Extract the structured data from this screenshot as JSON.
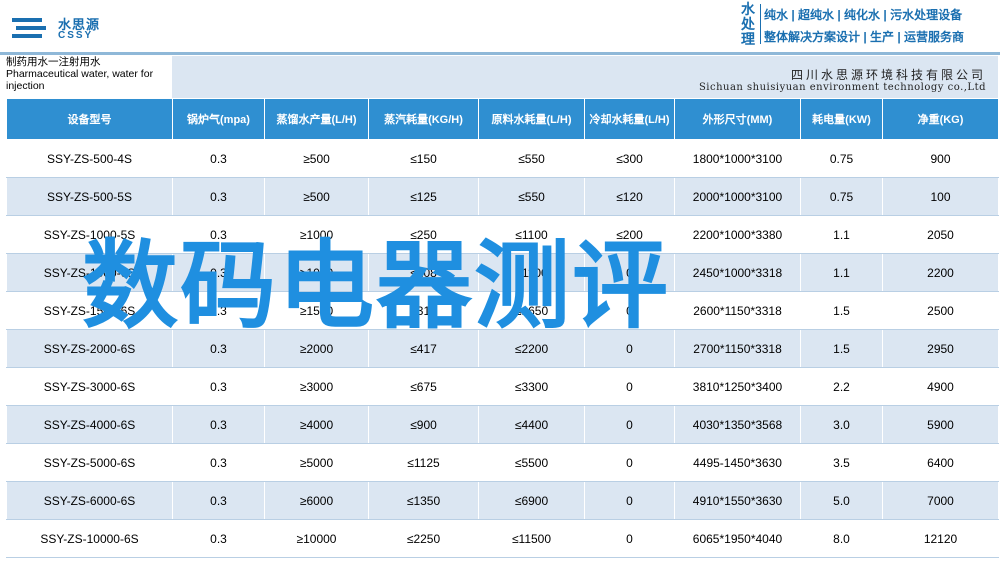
{
  "header": {
    "logo_cn": "水思源",
    "logo_en": "CSSY",
    "brand_vertical": "水处理",
    "brand_line1": "纯水 | 超纯水 | 纯化水 | 污水处理设备",
    "brand_line2": "整体解决方案设计 | 生产 | 运营服务商"
  },
  "title": {
    "cn": "制药用水一注射用水",
    "en_line1": "Pharmaceutical water, water for",
    "en_line2": "injection",
    "company_cn": "四川水思源环境科技有限公司",
    "company_en": "Sichuan shuisiyuan environment technology co.,Ltd"
  },
  "table": {
    "headers": [
      "设备型号",
      "锅炉气(mpa)",
      "蒸馏水产量(L/H)",
      "蒸汽耗量(KG/H)",
      "原料水耗量(L/H)",
      "冷却水耗量(L/H)",
      "外形尺寸(MM)",
      "耗电量(KW)",
      "净重(KG)"
    ],
    "rows": [
      [
        "SSY-ZS-500-4S",
        "0.3",
        "≥500",
        "≤150",
        "≤550",
        "≤300",
        "1800*1000*3100",
        "0.75",
        "900"
      ],
      [
        "SSY-ZS-500-5S",
        "0.3",
        "≥500",
        "≤125",
        "≤550",
        "≤120",
        "2000*1000*3100",
        "0.75",
        "100"
      ],
      [
        "SSY-ZS-1000-5S",
        "0.3",
        "≥1000",
        "≤250",
        "≤1100",
        "≤200",
        "2200*1000*3380",
        "1.1",
        "2050"
      ],
      [
        "SSY-ZS-1000-6S",
        "0.3",
        "≥1000",
        "≤208",
        "≤1100",
        "0",
        "2450*1000*3318",
        "1.1",
        "2200"
      ],
      [
        "SSY-ZS-1500-6S",
        "0.3",
        "≥1500",
        "≤313",
        "≤1650",
        "0",
        "2600*1150*3318",
        "1.5",
        "2500"
      ],
      [
        "SSY-ZS-2000-6S",
        "0.3",
        "≥2000",
        "≤417",
        "≤2200",
        "0",
        "2700*1150*3318",
        "1.5",
        "2950"
      ],
      [
        "SSY-ZS-3000-6S",
        "0.3",
        "≥3000",
        "≤675",
        "≤3300",
        "0",
        "3810*1250*3400",
        "2.2",
        "4900"
      ],
      [
        "SSY-ZS-4000-6S",
        "0.3",
        "≥4000",
        "≤900",
        "≤4400",
        "0",
        "4030*1350*3568",
        "3.0",
        "5900"
      ],
      [
        "SSY-ZS-5000-6S",
        "0.3",
        "≥5000",
        "≤1125",
        "≤5500",
        "0",
        "4495-1450*3630",
        "3.5",
        "6400"
      ],
      [
        "SSY-ZS-6000-6S",
        "0.3",
        "≥6000",
        "≤1350",
        "≤6900",
        "0",
        "4910*1550*3630",
        "5.0",
        "7000"
      ],
      [
        "SSY-ZS-10000-6S",
        "0.3",
        "≥10000",
        "≤2250",
        "≤11500",
        "0",
        "6065*1950*4040",
        "8.0",
        "12120"
      ]
    ]
  },
  "watermark": "数码电器测评",
  "colors": {
    "header_blue": "#2f8fd1",
    "row_alt": "#dbe6f2",
    "brand_blue": "#1a6fb0",
    "watermark_blue": "#1f8fe0"
  }
}
